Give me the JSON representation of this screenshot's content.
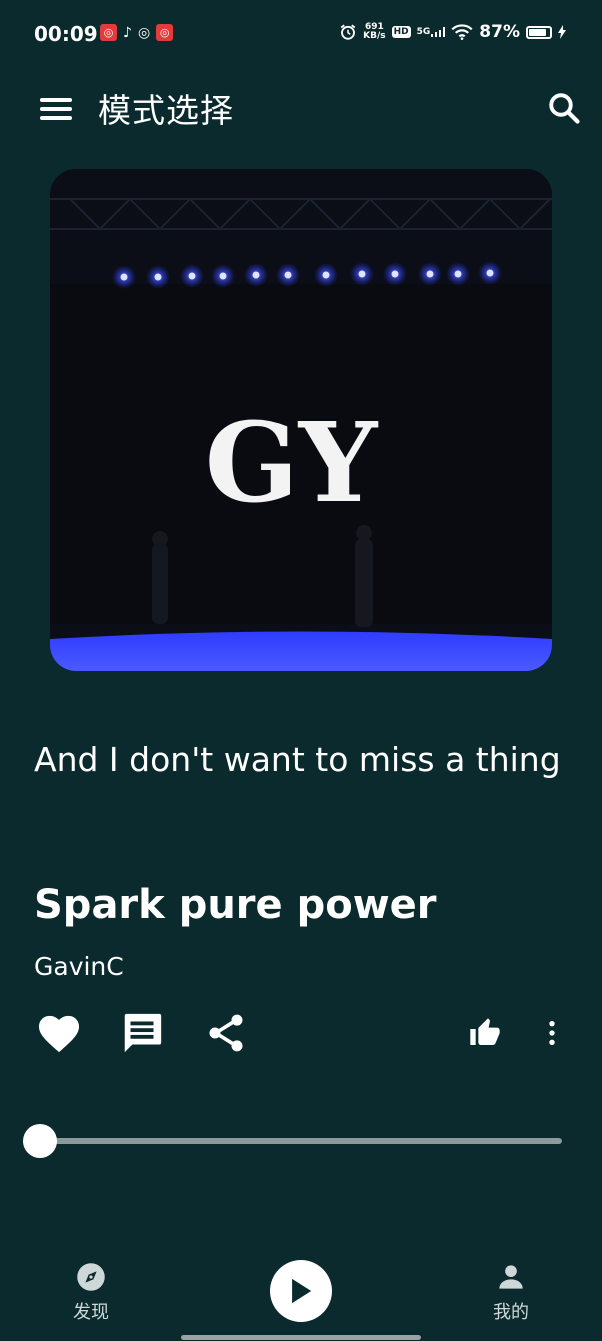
{
  "status_bar": {
    "time": "00:09",
    "network_speed_value": "691",
    "network_speed_unit": "KB/s",
    "hd_label": "HD",
    "signal_label": "5G",
    "battery_percent": "87%",
    "battery_level": 0.87
  },
  "header": {
    "title": "模式选择"
  },
  "player": {
    "album_art_text": "GY",
    "lyric_line": "And I don't want to miss a thing",
    "song_title": "Spark pure power",
    "artist": "GavinC",
    "progress_fraction": 0.0
  },
  "bottom_nav": {
    "discover_label": "发现",
    "mine_label": "我的"
  },
  "colors": {
    "background": "#0b2a2d",
    "stage_light": "#3b4bff",
    "text": "#ffffff"
  }
}
